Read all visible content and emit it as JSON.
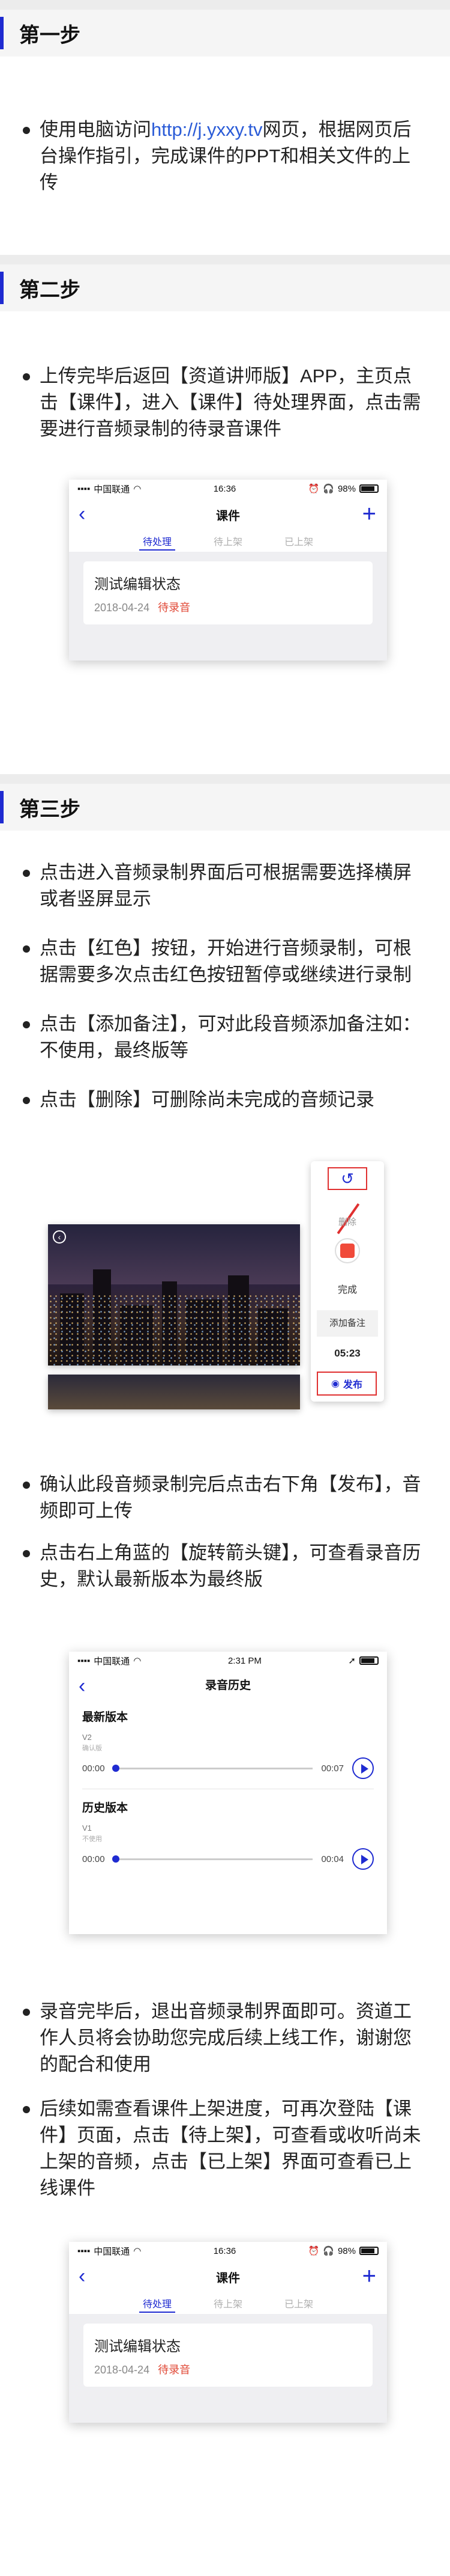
{
  "step1": {
    "title": "第一步",
    "bullet_pre": "使用电脑访问",
    "bullet_link": "http://j.yxxy.tv",
    "bullet_post": "网页，根据网页后台操作指引，完成课件的PPT和相关文件的上传"
  },
  "step2": {
    "title": "第二步",
    "bullet": "上传完毕后返回【资道讲师版】APP，主页点击【课件】，进入【课件】待处理界面，点击需要进行音频录制的待录音课件",
    "phone": {
      "carrier": "中国联通",
      "time": "16:36",
      "battery": "98%",
      "nav_title": "课件",
      "tabs": [
        "待处理",
        "待上架",
        "已上架"
      ],
      "card_title": "测试编辑状态",
      "card_date": "2018-04-24",
      "card_status": "待录音"
    }
  },
  "step3": {
    "title": "第三步",
    "bullets_a": [
      "点击进入音频录制界面后可根据需要选择横屏或者竖屏显示",
      "点击【红色】按钮，开始进行音频录制，可根据需要多次点击红色按钮暂停或继续进行录制",
      "点击【添加备注】，可对此段音频添加备注如：不使用，最终版等",
      "点击【删除】可删除尚未完成的音频记录"
    ],
    "recorder": {
      "delete_label": "删除",
      "done_label": "完成",
      "note_label": "添加备注",
      "time": "05:23",
      "publish_label": "发布"
    },
    "bullets_b": [
      "确认此段音频录制完后点击右下角【发布】，音频即可上传",
      "点击右上角蓝的【旋转箭头键】，可查看录音历史，默认最新版本为最终版"
    ],
    "history": {
      "carrier": "中国联通",
      "time": "2:31 PM",
      "nav_title": "录音历史",
      "latest_title": "最新版本",
      "latest_ver": "V2",
      "latest_note": "确认版",
      "latest_start": "00:00",
      "latest_end": "00:07",
      "older_title": "历史版本",
      "older_ver": "V1",
      "older_note": "不使用",
      "older_start": "00:00",
      "older_end": "00:04"
    },
    "bullets_c": [
      "录音完毕后，退出音频录制界面即可。资道工作人员将会协助您完成后续上线工作，谢谢您的配合和使用",
      "后续如需查看课件上架进度，可再次登陆【课件】页面，点击【待上架】，可查看或收听尚未上架的音频，点击【已上架】界面可查看已上线课件"
    ],
    "phone2": {
      "carrier": "中国联通",
      "time": "16:36",
      "battery": "98%",
      "nav_title": "课件",
      "tabs": [
        "待处理",
        "待上架",
        "已上架"
      ],
      "card_title": "测试编辑状态",
      "card_date": "2018-04-24",
      "card_status": "待录音"
    }
  }
}
